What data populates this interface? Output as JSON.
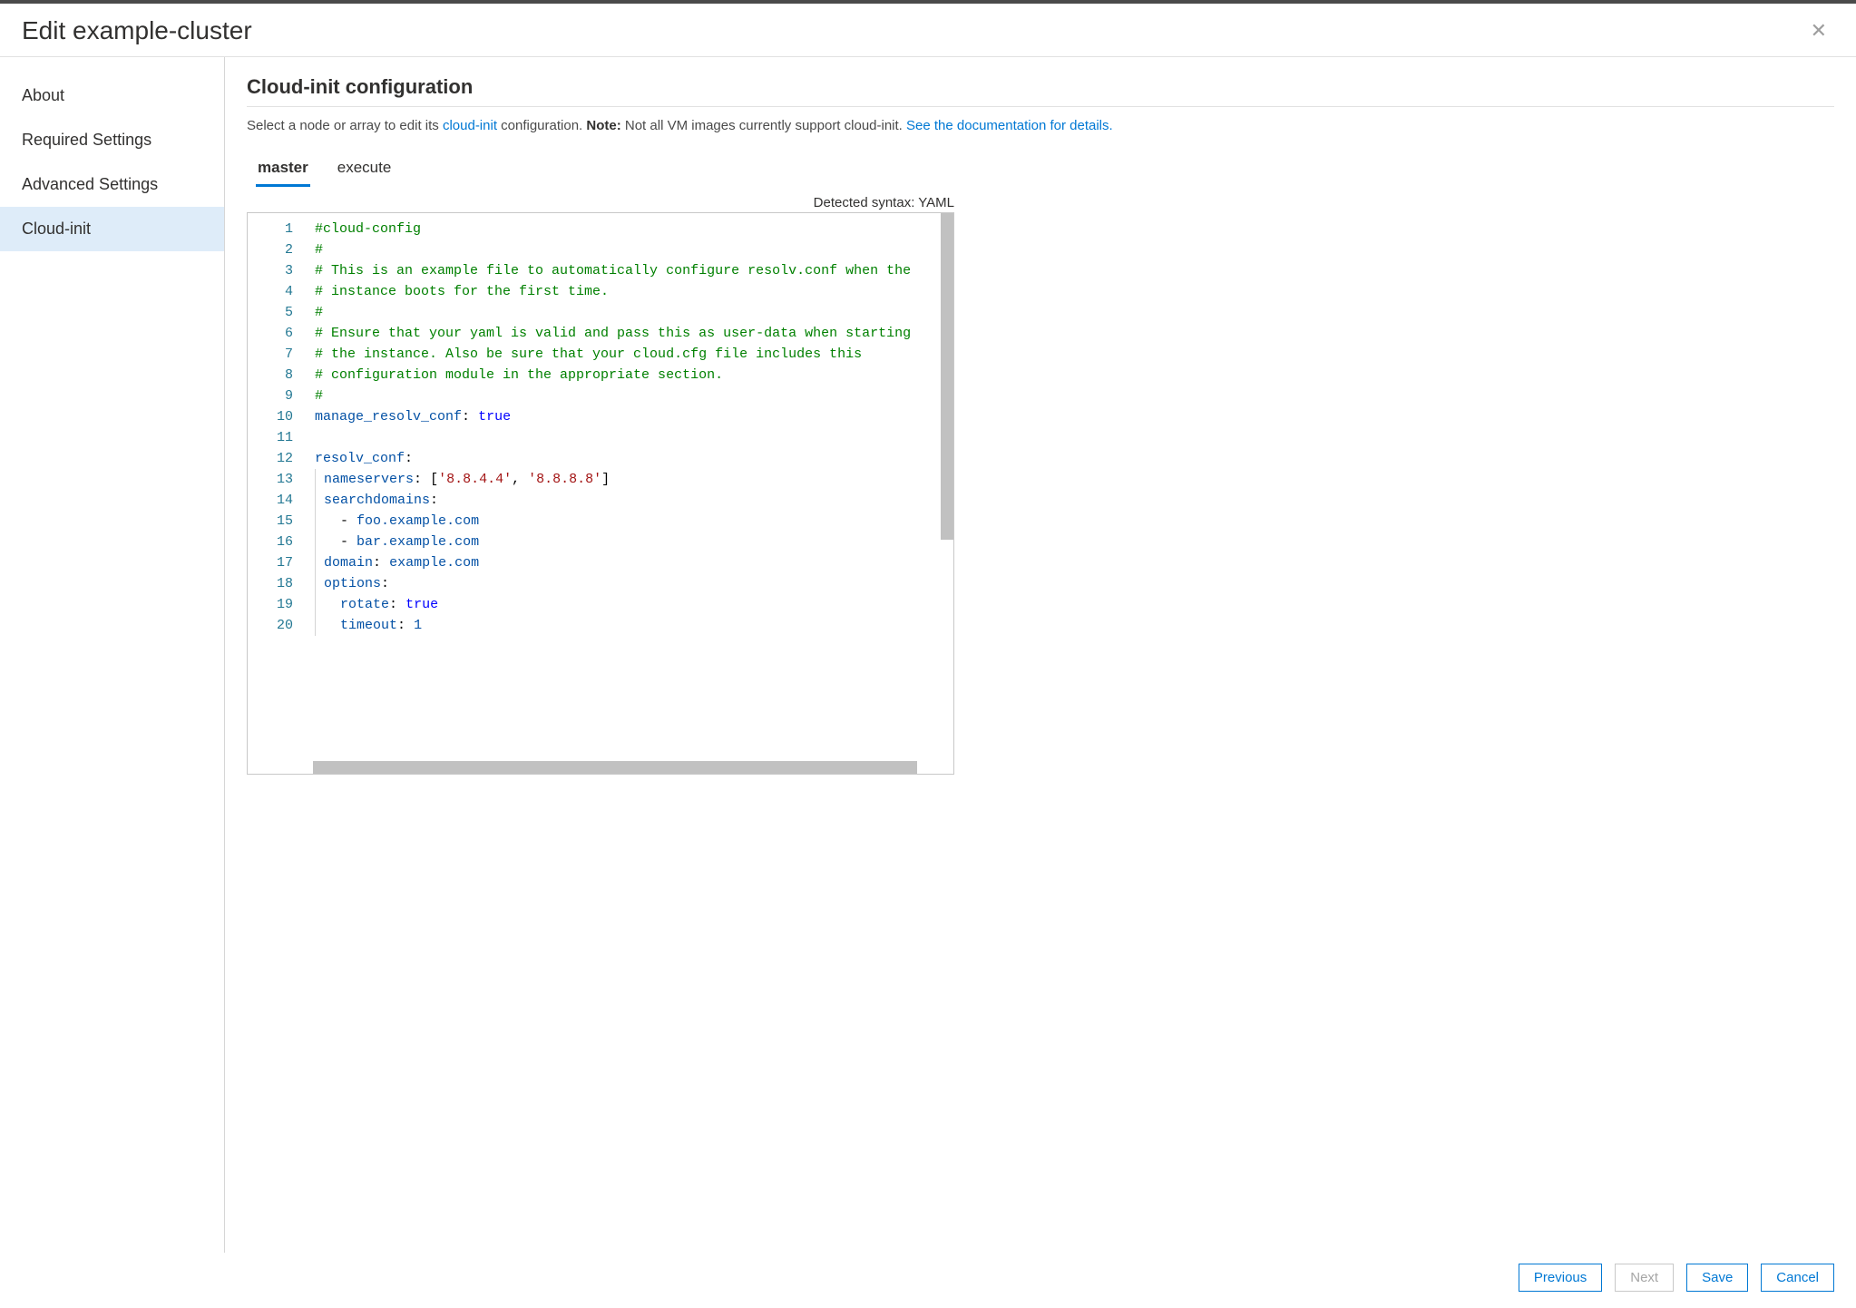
{
  "dialog": {
    "title": "Edit example-cluster"
  },
  "sidebar": {
    "items": [
      {
        "label": "About"
      },
      {
        "label": "Required Settings"
      },
      {
        "label": "Advanced Settings"
      },
      {
        "label": "Cloud-init",
        "active": true
      }
    ]
  },
  "main": {
    "title": "Cloud-init configuration",
    "desc_pre": "Select a node or array to edit its ",
    "desc_link1": "cloud-init",
    "desc_mid": " configuration. ",
    "desc_note_label": "Note:",
    "desc_note_text": " Not all VM images currently support cloud-init. ",
    "desc_link2": "See the documentation for details."
  },
  "tabs": [
    {
      "label": "master",
      "active": true
    },
    {
      "label": "execute"
    }
  ],
  "editor": {
    "syntax_label": "Detected syntax: YAML",
    "lines": [
      {
        "n": 1,
        "html": "<span class='c-comment'>#cloud-config</span>"
      },
      {
        "n": 2,
        "html": "<span class='c-comment'>#</span>"
      },
      {
        "n": 3,
        "html": "<span class='c-comment'># This is an example file to automatically configure resolv.conf when the</span>"
      },
      {
        "n": 4,
        "html": "<span class='c-comment'># instance boots for the first time.</span>"
      },
      {
        "n": 5,
        "html": "<span class='c-comment'>#</span>"
      },
      {
        "n": 6,
        "html": "<span class='c-comment'># Ensure that your yaml is valid and pass this as user-data when starting</span>"
      },
      {
        "n": 7,
        "html": "<span class='c-comment'># the instance. Also be sure that your cloud.cfg file includes this</span>"
      },
      {
        "n": 8,
        "html": "<span class='c-comment'># configuration module in the appropriate section.</span>"
      },
      {
        "n": 9,
        "html": "<span class='c-comment'>#</span>"
      },
      {
        "n": 10,
        "html": "<span class='c-key'>manage_resolv_conf</span><span class='c-punct'>:</span> <span class='c-bool'>true</span>"
      },
      {
        "n": 11,
        "html": ""
      },
      {
        "n": 12,
        "html": "<span class='c-key'>resolv_conf</span><span class='c-punct'>:</span>"
      },
      {
        "n": 13,
        "html": "<span class='indent-guide'></span> <span class='c-key'>nameservers</span><span class='c-punct'>:</span> <span class='c-punct'>[</span><span class='c-str'>'8.8.4.4'</span><span class='c-punct'>,</span> <span class='c-str'>'8.8.8.8'</span><span class='c-punct'>]</span>"
      },
      {
        "n": 14,
        "html": "<span class='indent-guide'></span> <span class='c-key'>searchdomains</span><span class='c-punct'>:</span>"
      },
      {
        "n": 15,
        "html": "<span class='indent-guide'></span>   <span class='c-punct'>-</span> <span class='c-plain'>foo.example.com</span>"
      },
      {
        "n": 16,
        "html": "<span class='indent-guide'></span>   <span class='c-punct'>-</span> <span class='c-plain'>bar.example.com</span>"
      },
      {
        "n": 17,
        "html": "<span class='indent-guide'></span> <span class='c-key'>domain</span><span class='c-punct'>:</span> <span class='c-plain'>example.com</span>"
      },
      {
        "n": 18,
        "html": "<span class='indent-guide'></span> <span class='c-key'>options</span><span class='c-punct'>:</span>"
      },
      {
        "n": 19,
        "html": "<span class='indent-guide'></span>   <span class='c-key'>rotate</span><span class='c-punct'>:</span> <span class='c-bool'>true</span>"
      },
      {
        "n": 20,
        "html": "<span class='indent-guide'></span>   <span class='c-key'>timeout</span><span class='c-punct'>:</span> <span class='c-plain'>1</span>"
      }
    ]
  },
  "footer": {
    "previous": "Previous",
    "next": "Next",
    "save": "Save",
    "cancel": "Cancel"
  }
}
